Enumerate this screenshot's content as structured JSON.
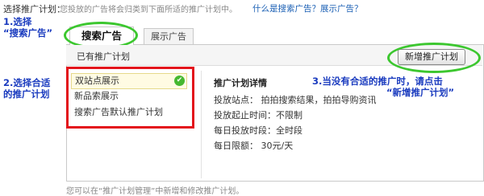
{
  "header": {
    "label": "选择推广计划：",
    "hint": "您投放的广告将会归类到下面所适的推广计划中。",
    "help_link": "什么是搜索广告？展示广告？"
  },
  "annotations": {
    "step1": "1.选择\n“搜索广告”",
    "step2": "2.选择合适\n的推广计划",
    "step3_prefix": "3.当没有合适的推广时，请点击",
    "step3_button": "“新增推广计划”"
  },
  "tabs": [
    {
      "label": "搜索广告",
      "active": true
    },
    {
      "label": "展示广告",
      "active": false
    }
  ],
  "section": {
    "title": "已有推广计划",
    "new_button": "新增推广计划"
  },
  "plans": [
    {
      "label": "双站点展示",
      "selected": true
    },
    {
      "label": "新品索展示",
      "selected": false
    },
    {
      "label": "搜索广告默认推广计划",
      "selected": false
    }
  ],
  "detail": {
    "title": "推广计划详情",
    "rows": [
      "投放站点：  拍拍搜索结果，拍拍导购资讯",
      "投放起止时间：不限制",
      "每日投放时段：全时段",
      "每日限额：  30元/天"
    ]
  },
  "footer": "您可以在“推广计划管理”中新增和修改推广计划。",
  "colors": {
    "annotation_blue": "#1a3bbf",
    "highlight_green": "#3cc72f",
    "highlight_red": "#e3121b",
    "link_blue": "#1a5fb4"
  }
}
